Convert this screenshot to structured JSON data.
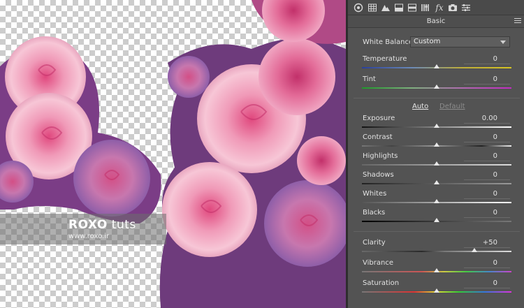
{
  "watermark": {
    "logo": "ROXO",
    "suffix": "tuts",
    "url": "www.roxo.ir"
  },
  "toolbar": {
    "icons": [
      "aperture-icon",
      "grid-icon",
      "mountain-icon",
      "split-toning-icon",
      "detail-icon",
      "hsl-icon",
      "fx-icon",
      "camera-icon",
      "presets-icon"
    ],
    "fx_label": "fx"
  },
  "panel": {
    "title": "Basic",
    "white_balance": {
      "label": "White Balance:",
      "value": "Custom"
    },
    "temperature": {
      "label": "Temperature",
      "value": "0",
      "level": 0.5
    },
    "tint": {
      "label": "Tint",
      "value": "0",
      "level": 0.5
    },
    "auto_label": "Auto",
    "default_label": "Default",
    "exposure": {
      "label": "Exposure",
      "value": "0.00",
      "level": 0.5
    },
    "contrast": {
      "label": "Contrast",
      "value": "0",
      "level": 0.5
    },
    "highlights": {
      "label": "Highlights",
      "value": "0",
      "level": 0.5
    },
    "shadows": {
      "label": "Shadows",
      "value": "0",
      "level": 0.5
    },
    "whites": {
      "label": "Whites",
      "value": "0",
      "level": 0.5
    },
    "blacks": {
      "label": "Blacks",
      "value": "0",
      "level": 0.5
    },
    "clarity": {
      "label": "Clarity",
      "value": "+50",
      "level": 0.75
    },
    "vibrance": {
      "label": "Vibrance",
      "value": "0",
      "level": 0.5
    },
    "saturation": {
      "label": "Saturation",
      "value": "0",
      "level": 0.5
    }
  },
  "colors": {
    "panel_bg": "#535353",
    "rose_pink": "#f2a6bf",
    "rose_deep": "#d8467c",
    "rose_purple": "#8a4f9c"
  }
}
